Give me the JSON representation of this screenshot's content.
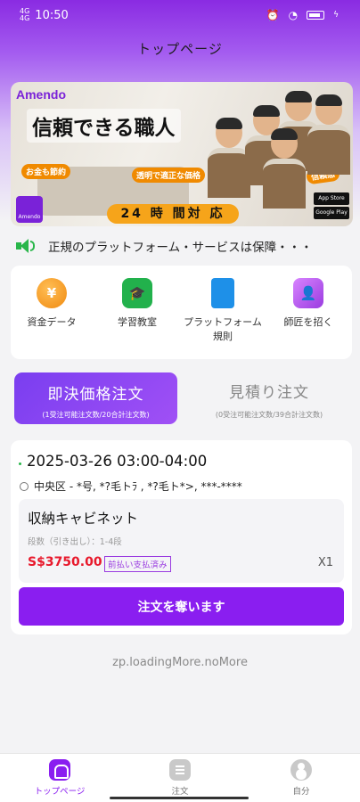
{
  "status_bar": {
    "network": "4G",
    "network2": "4G",
    "time": "10:50",
    "icons": [
      "alarm-icon",
      "wifi-icon",
      "battery-icon",
      "charging-icon"
    ]
  },
  "header": {
    "title": "トップページ"
  },
  "banner": {
    "brand": "Amendo",
    "headline": "信頼できる職人",
    "badge_a": "お金も節約",
    "badge_b": "",
    "badge_c": "透明で適正な価格",
    "badge_d": "信頼感",
    "hours": "24 時 間対 応",
    "store_1": "App Store",
    "store_2": "Google Play",
    "logo_text": "Amendo"
  },
  "notice": {
    "text": "正規のプラットフォーム・サービスは保障・・・"
  },
  "quick_links": [
    {
      "label": "資金データ",
      "icon": "money-icon",
      "glyph": "¥"
    },
    {
      "label": "学習教室",
      "icon": "graduation-cap-icon",
      "glyph": "🎓"
    },
    {
      "label": "プラットフォーム規則",
      "icon": "rules-book-icon",
      "glyph": ""
    },
    {
      "label": "師匠を招く",
      "icon": "invite-user-icon",
      "glyph": "👤"
    }
  ],
  "order_tabs": {
    "active": {
      "label": "即決価格注文",
      "sub": "(1受注可能注文数/20合計注文数)"
    },
    "inactive": {
      "label": "見積り注文",
      "sub": "(0受注可能注文数/39合計注文数)"
    }
  },
  "order": {
    "time": "2025-03-26 03:00-04:00",
    "address": "中央区 - *号, *?毛トﾗ , *?毛ト*>, ***-****",
    "item": {
      "name": "収納キャビネット",
      "spec": "段数（引き出し）：1-4段",
      "price": "S$3750.00",
      "payment_tag": "前払い支払済み",
      "qty": "X1"
    },
    "action_label": "注文を奪います"
  },
  "list_footer": "zp.loadingMore.noMore",
  "bottom_nav": [
    {
      "label": "トップページ",
      "icon": "home-icon",
      "active": true
    },
    {
      "label": "注文",
      "icon": "orders-icon",
      "active": false
    },
    {
      "label": "自分",
      "icon": "profile-icon",
      "active": false
    }
  ],
  "colors": {
    "brand": "#8a1ef0",
    "price": "#e8192c",
    "notice_icon": "#29b64a"
  }
}
